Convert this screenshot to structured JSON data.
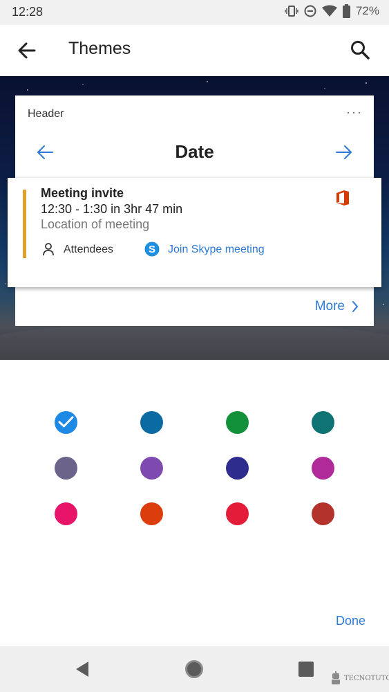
{
  "status_bar": {
    "time": "12:28",
    "battery": "72%"
  },
  "app_bar": {
    "title": "Themes"
  },
  "preview": {
    "header_label": "Header",
    "more_dots": "···",
    "date_label": "Date",
    "event": {
      "title": "Meeting invite",
      "time": "12:30 - 1:30  in 3hr 47 min",
      "location": "Location of meeting",
      "attendees_label": "Attendees",
      "skype_label": "Join Skype meeting",
      "accent_color": "#e0a030"
    },
    "more_label": "More"
  },
  "themes": {
    "selected_index": 0,
    "colors": [
      "#1e88e5",
      "#0b6aa2",
      "#13913a",
      "#0e7372",
      "#6b638a",
      "#7e4ab0",
      "#2e2d8d",
      "#b02a9a",
      "#e8146a",
      "#dc3d0c",
      "#e31c3a",
      "#b3332c"
    ]
  },
  "done_label": "Done",
  "watermark": "TECNOTUTO"
}
